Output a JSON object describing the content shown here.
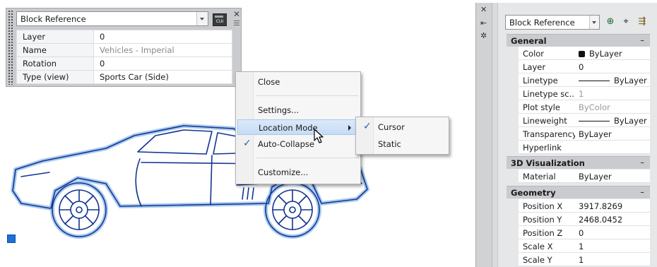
{
  "quick_properties": {
    "selector": "Block Reference",
    "cui_label": "CUI",
    "rows": [
      {
        "key": "Layer",
        "value": "0",
        "dim": false
      },
      {
        "key": "Name",
        "value": "Vehicles - Imperial",
        "dim": true
      },
      {
        "key": "Rotation",
        "value": "0",
        "dim": false
      },
      {
        "key": "Type (view)",
        "value": "Sports Car (Side)",
        "dim": false
      }
    ]
  },
  "context_menu": {
    "items": [
      "Close",
      "Settings...",
      "Location Mode",
      "Auto-Collapse",
      "Customize..."
    ],
    "auto_collapse_checked": "✓"
  },
  "submenu": {
    "items": [
      "Cursor",
      "Static"
    ],
    "cursor_checked": "✓"
  },
  "properties_palette": {
    "selector": "Block Reference",
    "sections": {
      "general": {
        "title": "General",
        "rows": [
          {
            "key": "Color",
            "value": "ByLayer"
          },
          {
            "key": "Layer",
            "value": "0"
          },
          {
            "key": "Linetype",
            "value": "ByLayer"
          },
          {
            "key": "Linetype sc...",
            "value": "1"
          },
          {
            "key": "Plot style",
            "value": "ByColor"
          },
          {
            "key": "Lineweight",
            "value": "ByLayer"
          },
          {
            "key": "Transparency",
            "value": "ByLayer"
          },
          {
            "key": "Hyperlink",
            "value": ""
          }
        ]
      },
      "visualization": {
        "title": "3D Visualization",
        "rows": [
          {
            "key": "Material",
            "value": "ByLayer"
          }
        ]
      },
      "geometry": {
        "title": "Geometry",
        "rows": [
          {
            "key": "Position X",
            "value": "3917.8269"
          },
          {
            "key": "Position Y",
            "value": "2468.0452"
          },
          {
            "key": "Position Z",
            "value": "0"
          },
          {
            "key": "Scale X",
            "value": "1"
          },
          {
            "key": "Scale Y",
            "value": "1"
          }
        ]
      }
    },
    "collapse_glyph": "–"
  },
  "colors": {
    "selection_blue": "#1e6fd8",
    "menu_highlight": "#c5dcf6",
    "panel_gray": "#c9cbce"
  },
  "icons": [
    "close-icon",
    "pin-icon",
    "properties-icon",
    "quick-select-icon",
    "pick-objects-icon",
    "select-objects-icon",
    "check-icon",
    "arrow-cursor-icon"
  ]
}
